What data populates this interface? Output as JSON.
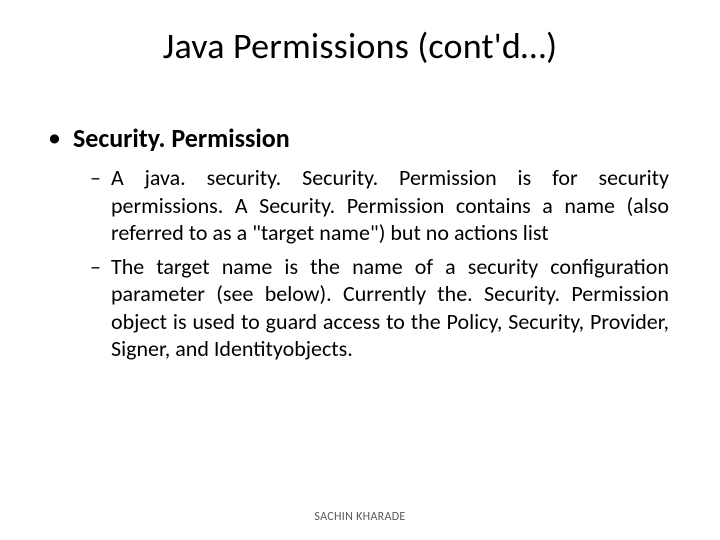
{
  "title": "Java Permissions (cont'd…)",
  "heading": "Security. Permission",
  "paragraphs": {
    "p1": "A java. security. Security. Permission is for security permissions. A Security. Permission contains a name (also referred to as a \"target name\") but no actions list",
    "p2": "The target name is the name of a security configuration parameter (see below). Currently the. Security. Permission object is used to guard access to the Policy, Security, Provider, Signer, and Identityobjects."
  },
  "footer": "SACHIN KHARADE"
}
